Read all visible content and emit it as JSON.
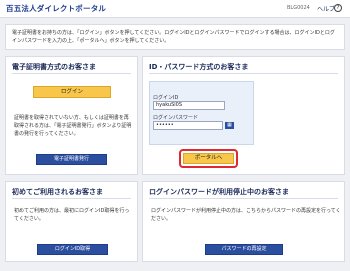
{
  "header": {
    "logo": "百五法人ダイレクトポータル",
    "code": "BLG0024",
    "help_label": "ヘルプ",
    "help_icon": "?"
  },
  "notice": {
    "text": "電子証明書をお持ちの方は、「ログイン」ボタンを押してください。ログインIDとログインパスワードでログインする場合は、ログインIDとログインパスワードを入力の上、「ポータルへ」ボタンを押してください。"
  },
  "panels": {
    "cert": {
      "title": "電子証明書方式のお客さま",
      "login_button": "ログイン",
      "description": "証明書を取得されていない方、もしくは証明書を再取得される方は、「電子証明書発行」ボタンより証明書の発行を行ってください。",
      "issue_button": "電子証明書発行"
    },
    "idpw": {
      "title": "ID・パスワード方式のお客さま",
      "id_label": "ログインID",
      "id_value": "hyakuSl0S",
      "pw_label": "ログインパスワード",
      "pw_value": "••••••",
      "keyboard_icon": "▦",
      "portal_button": "ポータルへ"
    },
    "first": {
      "title": "初めてご利用されるお客さま",
      "description": "初めてご利用の方は、最初にログインID取得を行ってください。",
      "button": "ログインID取得"
    },
    "locked": {
      "title": "ログインパスワードが利用停止中のお客さま",
      "description": "ログインパスワードが利用停止中の方は、こちらからパスワードの再設定を行ってください。",
      "button": "パスワードの再設定"
    }
  }
}
